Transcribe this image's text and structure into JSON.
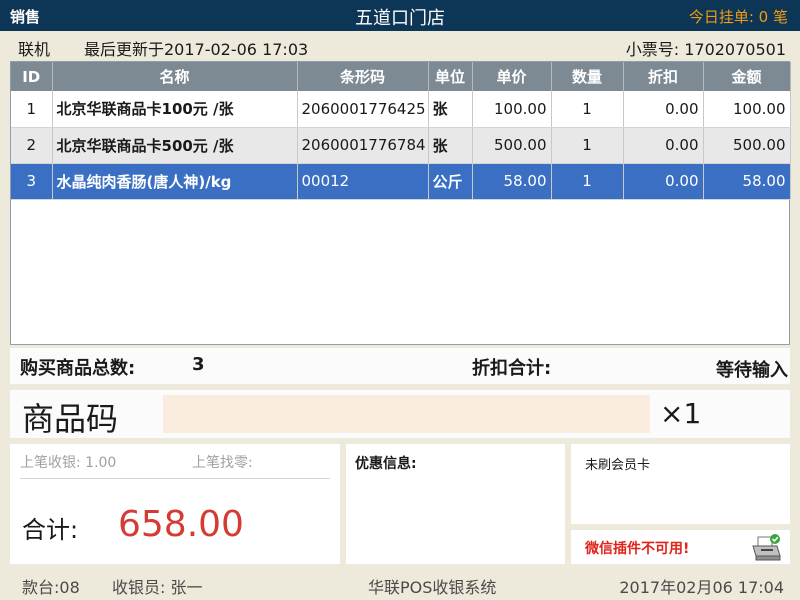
{
  "topbar": {
    "mode": "销售",
    "store": "五道口门店",
    "hold_label": "今日挂单:",
    "hold_count": "0",
    "hold_unit": "笔"
  },
  "status": {
    "connection": "联机",
    "last_update": "最后更新于2017-02-06 17:03",
    "ticket_label": "小票号:",
    "ticket_no": "1702070501"
  },
  "table": {
    "headers": [
      "ID",
      "名称",
      "条形码",
      "单位",
      "单价",
      "数量",
      "折扣",
      "金额"
    ],
    "rows": [
      [
        "1",
        "北京华联商品卡100元 /张",
        "2060001776425",
        "张",
        "100.00",
        "1",
        "0.00",
        "100.00"
      ],
      [
        "2",
        "北京华联商品卡500元 /张",
        "2060001776784",
        "张",
        "500.00",
        "1",
        "0.00",
        "500.00"
      ],
      [
        "3",
        "水晶纯肉香肠(唐人神)/kg",
        "00012",
        "公斤",
        "58.00",
        "1",
        "0.00",
        "58.00"
      ]
    ]
  },
  "summary": {
    "total_qty_label": "购买商品总数:",
    "total_qty": "3",
    "discount_label": "折扣合计:",
    "discount_value": "等待输入"
  },
  "entry": {
    "label": "商品码",
    "value": "",
    "multiplier": "×1"
  },
  "payment": {
    "last_paid": "上笔收银: 1.00",
    "last_change": "上笔找零:",
    "total_label": "合计:",
    "total_value": "658.00"
  },
  "promo": {
    "label": "优惠信息:"
  },
  "member": {
    "status": "未刷会员卡"
  },
  "wechat": {
    "status": "微信插件不可用!"
  },
  "footer": {
    "register": "款台:08",
    "cashier": "收银员: 张一",
    "system": "华联POS收银系统",
    "datetime": "2017年02月06  17:04"
  },
  "colors": {
    "topbar_bg": "#0c3556",
    "hold_accent": "#f39c12",
    "selected_row": "#3a6fc4",
    "total_red": "#d43b33",
    "wechat_red": "#e0231b"
  }
}
